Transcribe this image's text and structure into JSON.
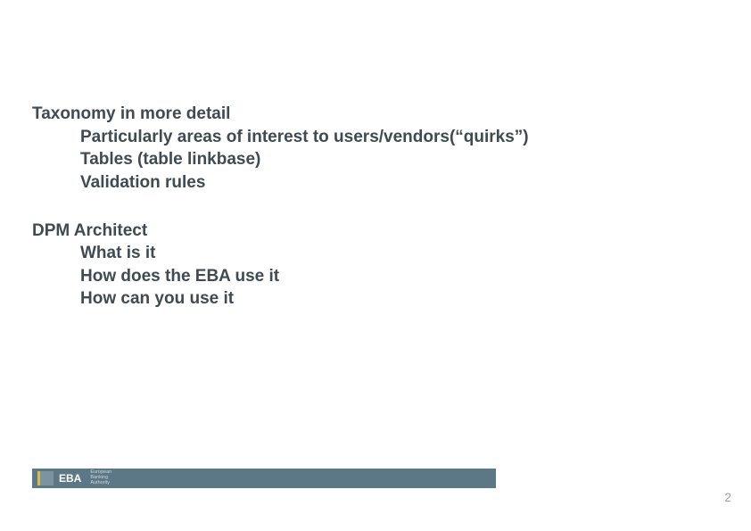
{
  "content": {
    "sections": [
      {
        "title": "Taxonomy in more detail",
        "items": [
          "Particularly areas of interest to users/vendors(“quirks”)",
          "Tables (table linkbase)",
          "Validation rules"
        ]
      },
      {
        "title": "DPM Architect",
        "items": [
          "What is it",
          "How does the EBA use it",
          "How can you use it"
        ]
      }
    ]
  },
  "footer": {
    "brand": "EBA",
    "subline": "European\nBanking\nAuthority",
    "page_number": "2"
  }
}
